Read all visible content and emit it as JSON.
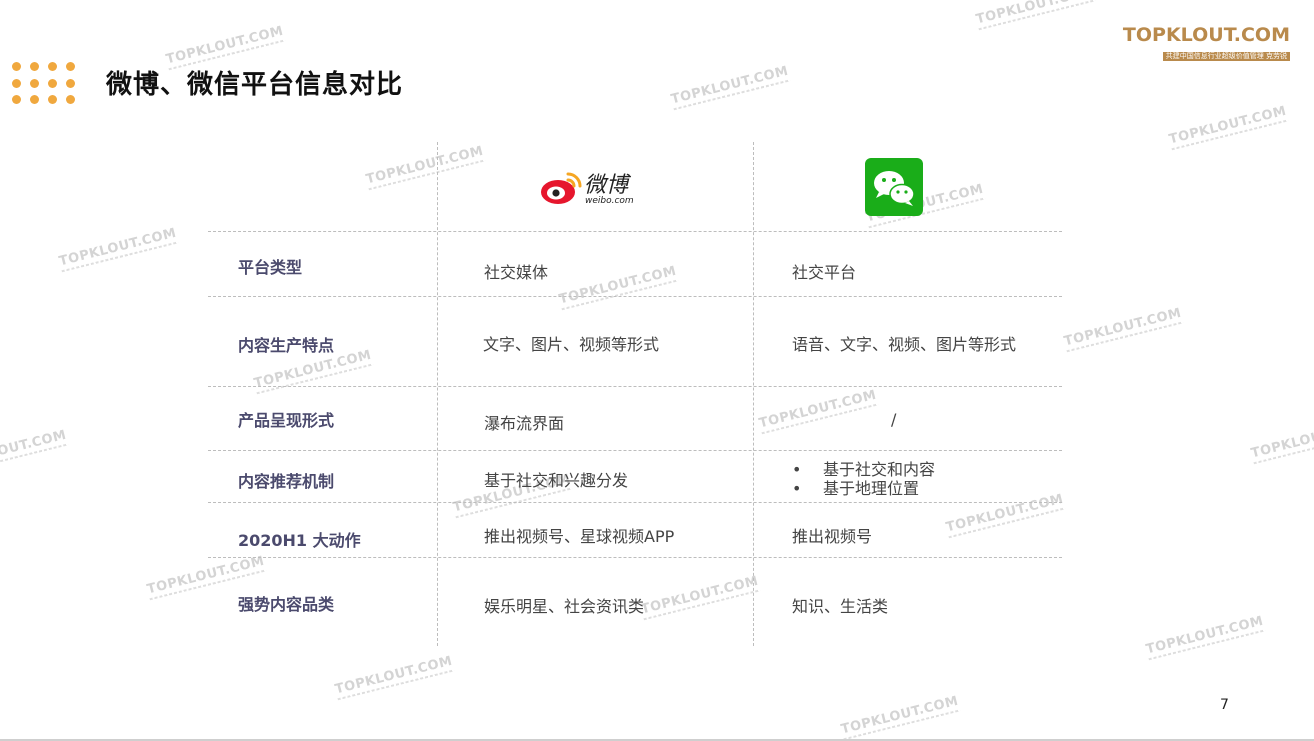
{
  "title": "微博、微信平台信息对比",
  "brand": {
    "name": "TOPKLOUT.COM",
    "tagline": "共建中国信息行业超级价值管理",
    "cn": "克劳锐"
  },
  "watermark_text": "TOPKLOUT.COM",
  "logos": {
    "weibo_text": "微博",
    "weibo_domain": "weibo.com"
  },
  "rows": [
    {
      "label": "平台类型",
      "weibo": "社交媒体",
      "wechat": "社交平台"
    },
    {
      "label": "内容生产特点",
      "weibo": "文字、图片、视频等形式",
      "wechat": "语音、文字、视频、图片等形式"
    },
    {
      "label": "产品呈现形式",
      "weibo": "瀑布流界面",
      "wechat": "/"
    },
    {
      "label": "内容推荐机制",
      "weibo": "基于社交和兴趣分发",
      "wechat_bullets": [
        "基于社交和内容",
        "基于地理位置"
      ]
    },
    {
      "label": "2020H1 大动作",
      "weibo": "推出视频号、星球视频APP",
      "wechat": "推出视频号"
    },
    {
      "label": "强势内容品类",
      "weibo": "娱乐明星、社会资讯类",
      "wechat": "知识、生活类"
    }
  ],
  "page_number": "7",
  "colors": {
    "accent_orange": "#f0a83e",
    "label_purple": "#4b4a6d",
    "brand_gold": "#b98a4c",
    "wechat_green": "#1aad19",
    "weibo_red": "#e6162d"
  }
}
